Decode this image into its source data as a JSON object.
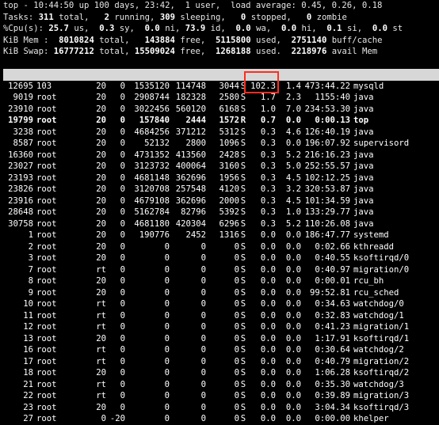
{
  "summary": {
    "line1": "top - 10:44:50 up 100 days, 23:42,  1 user,  load average: 0.45, 0.26, 0.18",
    "tasks": {
      "label": "Tasks:",
      "total": "311",
      "total_label": "total,",
      "running": "2",
      "running_label": "running,",
      "sleeping": "309",
      "sleeping_label": "sleeping,",
      "stopped": "0",
      "stopped_label": "stopped,",
      "zombie": "0",
      "zombie_label": "zombie"
    },
    "cpu": {
      "label": "%Cpu(s):",
      "us": "25.7",
      "us_label": "us,",
      "sy": "0.3",
      "sy_label": "sy,",
      "ni": "0.0",
      "ni_label": "ni,",
      "id": "73.9",
      "id_label": "id,",
      "wa": "0.0",
      "wa_label": "wa,",
      "hi": "0.0",
      "hi_label": "hi,",
      "si": "0.1",
      "si_label": "si,",
      "st": "0.0",
      "st_label": "st"
    },
    "mem": {
      "label": "KiB Mem :",
      "total": "8010824",
      "total_label": "total,",
      "free": "143884",
      "free_label": "free,",
      "used": "5115800",
      "used_label": "used,",
      "buff": "2751140",
      "buff_label": "buff/cache"
    },
    "swap": {
      "label": "KiB Swap:",
      "total": "16777212",
      "total_label": "total,",
      "free": "15509024",
      "free_label": "free,",
      "used": "1268188",
      "used_label": "used.",
      "avail": "2218976",
      "avail_label": "avail Mem"
    }
  },
  "columns": [
    "PID",
    "USER",
    "PR",
    "NI",
    "VIRT",
    "RES",
    "SHR",
    "S",
    "%CPU",
    "%MEM",
    "TIME+",
    "COMMAND"
  ],
  "processes": [
    [
      "12695",
      "103",
      "20",
      "0",
      "1535120",
      "114748",
      "3044",
      "S",
      "102.3",
      "1.4",
      "473:44.22",
      "mysqld"
    ],
    [
      "9019",
      "root",
      "20",
      "0",
      "2908744",
      "182328",
      "2580",
      "S",
      "1.7",
      "2.3",
      "1155:40",
      "java"
    ],
    [
      "23910",
      "root",
      "20",
      "0",
      "3022456",
      "560120",
      "6168",
      "S",
      "1.0",
      "7.0",
      "234:53.30",
      "java"
    ],
    [
      "19799",
      "root",
      "20",
      "0",
      "157840",
      "2444",
      "1572",
      "R",
      "0.7",
      "0.0",
      "0:00.13",
      "top"
    ],
    [
      "3238",
      "root",
      "20",
      "0",
      "4684256",
      "371212",
      "5312",
      "S",
      "0.3",
      "4.6",
      "126:40.19",
      "java"
    ],
    [
      "8587",
      "root",
      "20",
      "0",
      "52132",
      "2800",
      "1096",
      "S",
      "0.3",
      "0.0",
      "196:07.92",
      "supervisord"
    ],
    [
      "16360",
      "root",
      "20",
      "0",
      "4731352",
      "413560",
      "2428",
      "S",
      "0.3",
      "5.2",
      "216:16.23",
      "java"
    ],
    [
      "23027",
      "root",
      "20",
      "0",
      "3123732",
      "400064",
      "3160",
      "S",
      "0.3",
      "5.0",
      "252:55.57",
      "java"
    ],
    [
      "23193",
      "root",
      "20",
      "0",
      "4681148",
      "362696",
      "1956",
      "S",
      "0.3",
      "4.5",
      "102:12.25",
      "java"
    ],
    [
      "23826",
      "root",
      "20",
      "0",
      "3120708",
      "257548",
      "4120",
      "S",
      "0.3",
      "3.2",
      "320:53.87",
      "java"
    ],
    [
      "23916",
      "root",
      "20",
      "0",
      "4679108",
      "362696",
      "2000",
      "S",
      "0.3",
      "4.5",
      "101:34.59",
      "java"
    ],
    [
      "28648",
      "root",
      "20",
      "0",
      "5162784",
      "82796",
      "5392",
      "S",
      "0.3",
      "1.0",
      "133:29.77",
      "java"
    ],
    [
      "30758",
      "root",
      "20",
      "0",
      "4681180",
      "420304",
      "6296",
      "S",
      "0.3",
      "5.2",
      "110:26.08",
      "java"
    ],
    [
      "1",
      "root",
      "20",
      "0",
      "190776",
      "2452",
      "1316",
      "S",
      "0.0",
      "0.0",
      "186:47.77",
      "systemd"
    ],
    [
      "2",
      "root",
      "20",
      "0",
      "0",
      "0",
      "0",
      "S",
      "0.0",
      "0.0",
      "0:02.66",
      "kthreadd"
    ],
    [
      "3",
      "root",
      "20",
      "0",
      "0",
      "0",
      "0",
      "S",
      "0.0",
      "0.0",
      "0:40.55",
      "ksoftirqd/0"
    ],
    [
      "7",
      "root",
      "rt",
      "0",
      "0",
      "0",
      "0",
      "S",
      "0.0",
      "0.0",
      "0:40.97",
      "migration/0"
    ],
    [
      "8",
      "root",
      "20",
      "0",
      "0",
      "0",
      "0",
      "S",
      "0.0",
      "0.0",
      "0:00.01",
      "rcu_bh"
    ],
    [
      "9",
      "root",
      "20",
      "0",
      "0",
      "0",
      "0",
      "S",
      "0.0",
      "0.0",
      "99:52.81",
      "rcu_sched"
    ],
    [
      "10",
      "root",
      "rt",
      "0",
      "0",
      "0",
      "0",
      "S",
      "0.0",
      "0.0",
      "0:34.63",
      "watchdog/0"
    ],
    [
      "11",
      "root",
      "rt",
      "0",
      "0",
      "0",
      "0",
      "S",
      "0.0",
      "0.0",
      "0:32.83",
      "watchdog/1"
    ],
    [
      "12",
      "root",
      "rt",
      "0",
      "0",
      "0",
      "0",
      "S",
      "0.0",
      "0.0",
      "0:41.23",
      "migration/1"
    ],
    [
      "13",
      "root",
      "20",
      "0",
      "0",
      "0",
      "0",
      "S",
      "0.0",
      "0.0",
      "1:17.91",
      "ksoftirqd/1"
    ],
    [
      "16",
      "root",
      "rt",
      "0",
      "0",
      "0",
      "0",
      "S",
      "0.0",
      "0.0",
      "0:30.64",
      "watchdog/2"
    ],
    [
      "17",
      "root",
      "rt",
      "0",
      "0",
      "0",
      "0",
      "S",
      "0.0",
      "0.0",
      "0:40.79",
      "migration/2"
    ],
    [
      "18",
      "root",
      "20",
      "0",
      "0",
      "0",
      "0",
      "S",
      "0.0",
      "0.0",
      "1:06.28",
      "ksoftirqd/2"
    ],
    [
      "21",
      "root",
      "rt",
      "0",
      "0",
      "0",
      "0",
      "S",
      "0.0",
      "0.0",
      "0:35.30",
      "watchdog/3"
    ],
    [
      "22",
      "root",
      "rt",
      "0",
      "0",
      "0",
      "0",
      "S",
      "0.0",
      "0.0",
      "0:39.89",
      "migration/3"
    ],
    [
      "23",
      "root",
      "20",
      "0",
      "0",
      "0",
      "0",
      "S",
      "0.0",
      "0.0",
      "3:04.34",
      "ksoftirqd/3"
    ],
    [
      "27",
      "root",
      "0",
      "-20",
      "0",
      "0",
      "0",
      "S",
      "0.0",
      "0.0",
      "0:00.00",
      "khelper"
    ]
  ],
  "bold_row_index": 3,
  "colors": {
    "background": "#000000",
    "text": "#ffffff",
    "header_bg": "#d7d7d7",
    "highlight": "#ff2d1f"
  }
}
